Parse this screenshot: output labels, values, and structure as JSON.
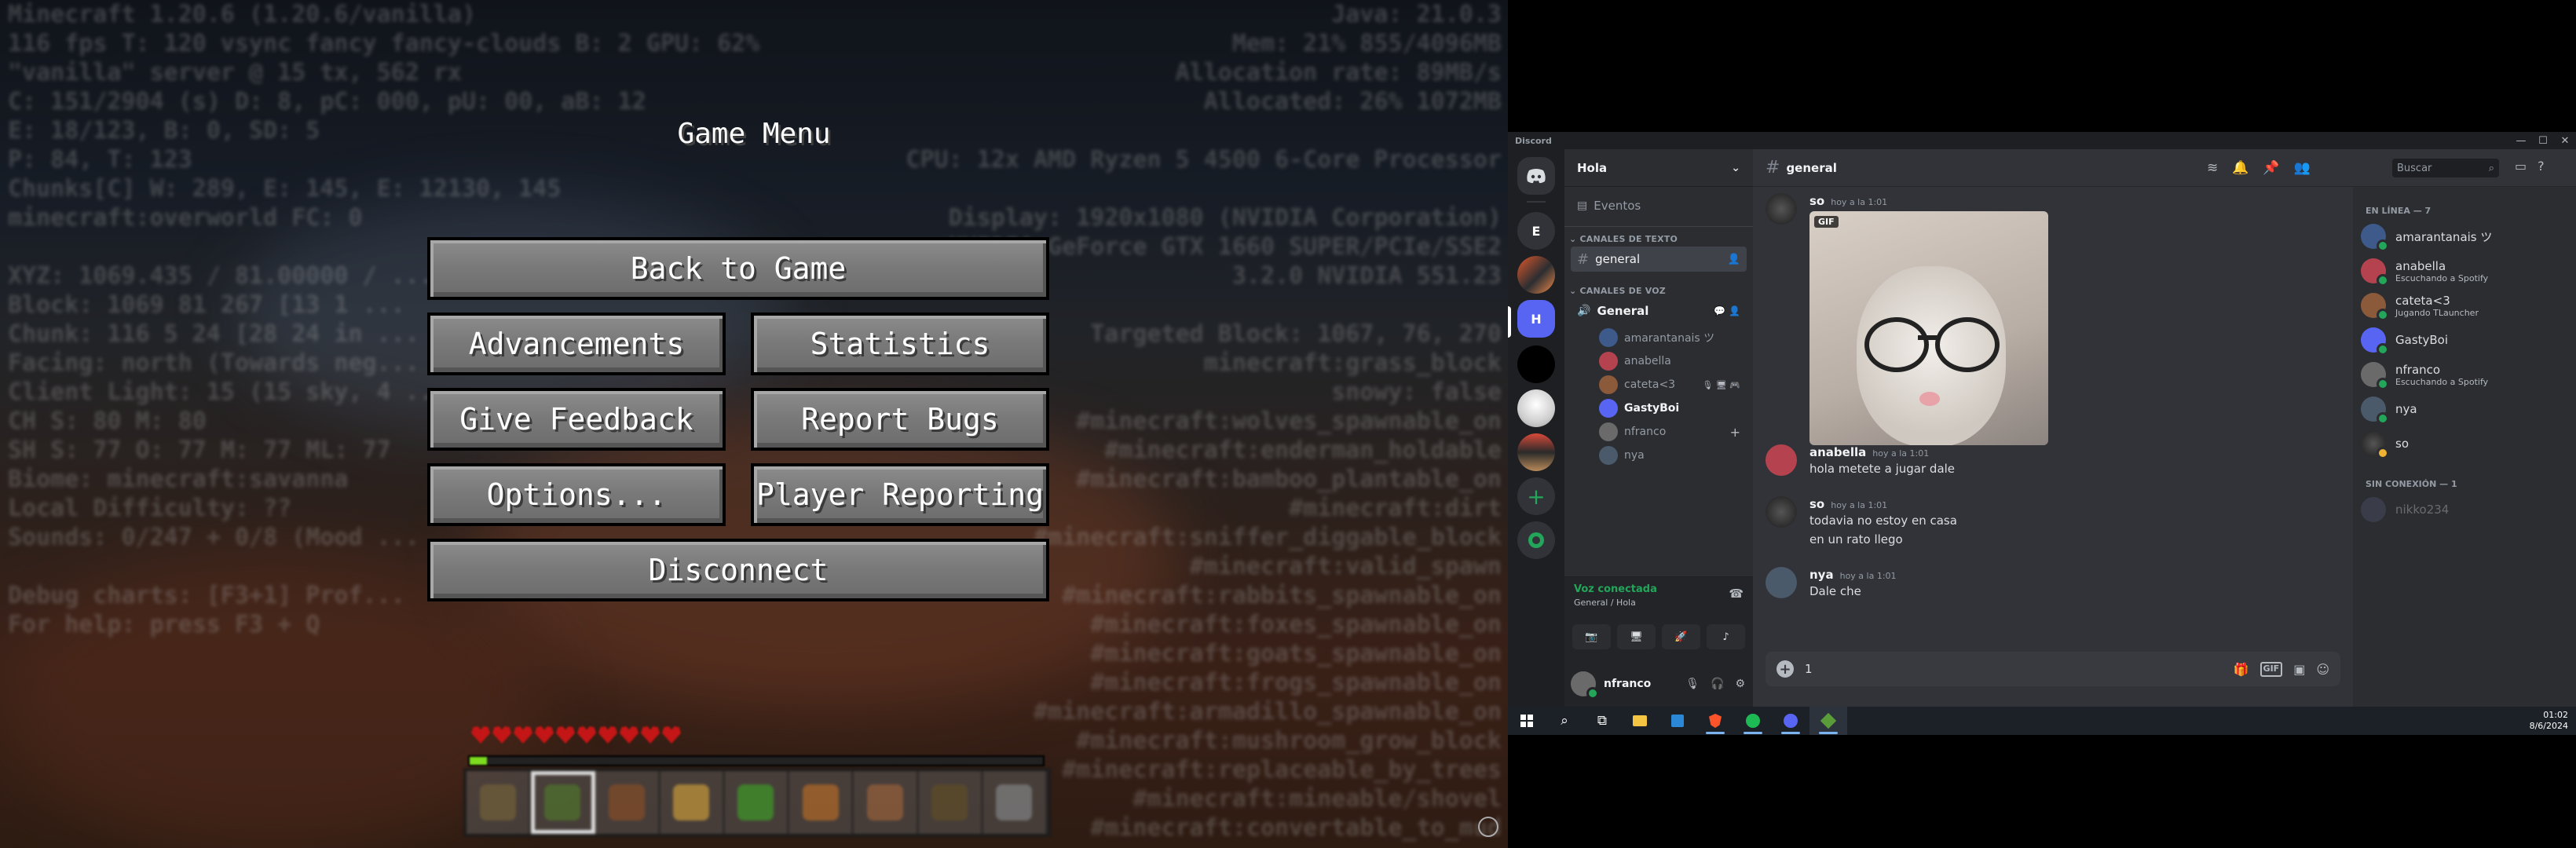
{
  "minecraft": {
    "menu_title": "Game Menu",
    "buttons": {
      "back": "Back to Game",
      "advancements": "Advancements",
      "statistics": "Statistics",
      "feedback": "Give Feedback",
      "bugs": "Report Bugs",
      "options": "Options...",
      "player_reporting": "Player Reporting",
      "disconnect": "Disconnect"
    },
    "debug_left": "Minecraft 1.20.6 (1.20.6/vanilla)\n116 fps T: 120 vsync fancy fancy-clouds B: 2 GPU: 62%\n\"vanilla\" server @ 15 tx, 562 rx\nC: 151/2904 (s) D: 8, pC: 000, pU: 00, aB: 12\nE: 18/123, B: 0, SD: 5\nP: 84, T: 123\nChunks[C] W: 289, E: 145, E: 12130, 145\nminecraft:overworld FC: 0\n\nXYZ: 1069.435 / 81.00000 / ...\nBlock: 1069 81 267 [13 1 ...\nChunk: 116 5 24 [28 24 in ...\nFacing: north (Towards neg...\nClient Light: 15 (15 sky, 4 ...\nCH S: 80 M: 80\nSH S: 77 O: 77 M: 77 ML: 77\nBiome: minecraft:savanna\nLocal Difficulty: ??\nSounds: 0/247 + 0/8 (Mood ...\n\nDebug charts: [F3+1] Prof...\nFor help: press F3 + Q",
    "debug_right": "Java: 21.0.3\nMem: 21% 855/4096MB\nAllocation rate: 89MB/s\nAllocated: 26% 1072MB\n\nCPU: 12x AMD Ryzen 5 4500 6-Core Processor\n\nDisplay: 1920x1080 (NVIDIA Corporation)\nNVIDIA GeForce GTX 1660 SUPER/PCIe/SSE2\n3.2.0 NVIDIA 551.23\n\nTargeted Block: 1067, 76, 270\nminecraft:grass_block\nsnowy: false\n#minecraft:wolves_spawnable_on\n#minecraft:enderman_holdable\n#minecraft:bamboo_plantable_on\n#minecraft:dirt\n#minecraft:sniffer_diggable_block\n#minecraft:valid_spawn\n#minecraft:rabbits_spawnable_on\n#minecraft:foxes_spawnable_on\n#minecraft:goats_spawnable_on\n#minecraft:frogs_spawnable_on\n#minecraft:armadillo_spawnable_on\n#minecraft:mushroom_grow_block\n#minecraft:replaceable_by_trees\n#minecraft:mineable/shovel\n#minecraft:convertable_to_mud"
  },
  "discord": {
    "app_title": "Discord",
    "server_name": "Hola",
    "server_initial": "H",
    "guild_e": "E",
    "events": "Eventos",
    "cat_text": "CANALES DE TEXTO",
    "cat_voice": "CANALES DE VOZ",
    "text_channel": "general",
    "voice_channel": "General",
    "voice_users": [
      "amarantanais ツ",
      "anabella",
      "cateta<3",
      "GastyBoi",
      "nfranco",
      "nya"
    ],
    "voice_status": "Voz conectada",
    "voice_location": "General / Hola",
    "user_name": "nfranco",
    "channel_title": "general",
    "search_placeholder": "Buscar",
    "messages": [
      {
        "author": "so",
        "time": "hoy a la 1:01",
        "text": "",
        "gif": "GIF"
      },
      {
        "author": "anabella",
        "time": "hoy a la 1:01",
        "text": "hola metete a jugar dale"
      },
      {
        "author": "so",
        "time": "hoy a la 1:01",
        "text": "todavia no estoy en casa",
        "text2": "en un rato llego"
      },
      {
        "author": "nya",
        "time": "hoy a la 1:01",
        "text": "Dale che"
      }
    ],
    "composer_text": "1",
    "online_header": "EN LÍNEA — 7",
    "offline_header": "SIN CONEXIÓN — 1",
    "members": [
      {
        "name": "amarantanais ツ",
        "sub": ""
      },
      {
        "name": "anabella",
        "sub": "Escuchando a Spotify"
      },
      {
        "name": "cateta<3",
        "sub": "Jugando TLauncher"
      },
      {
        "name": "GastyBoi",
        "sub": ""
      },
      {
        "name": "nfranco",
        "sub": "Escuchando a Spotify"
      },
      {
        "name": "nya",
        "sub": ""
      },
      {
        "name": "so",
        "sub": ""
      }
    ],
    "offline_member": "nikko234",
    "clock_time": "01:02",
    "clock_date": "8/6/2024",
    "colors": {
      "blurple": "#5865f2",
      "green": "#23a55a",
      "bg": "#313338"
    }
  }
}
